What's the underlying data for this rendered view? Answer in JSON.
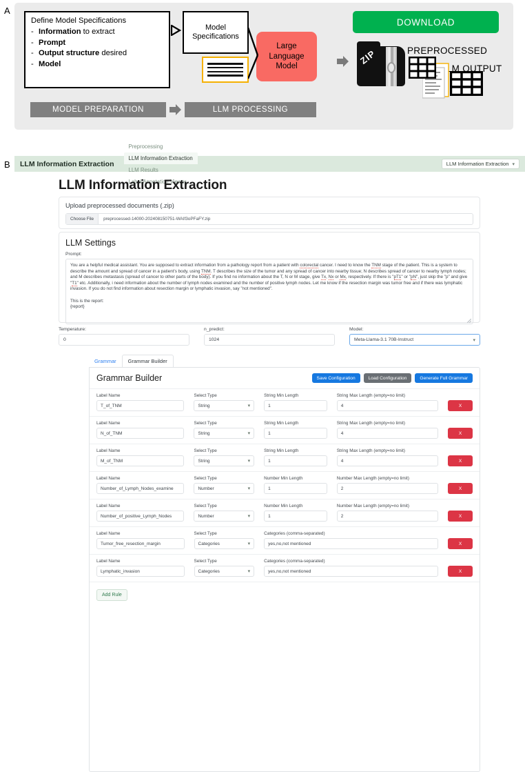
{
  "panels": {
    "a_letter": "A",
    "b_letter": "B"
  },
  "diagram": {
    "spec_box": {
      "title": "Define Model Specifications",
      "items": [
        {
          "bold": "Information",
          "rest": " to extract"
        },
        {
          "bold": "Prompt",
          "rest": ""
        },
        {
          "bold": "Output structure",
          "rest": " desired"
        },
        {
          "bold": "Model",
          "rest": ""
        }
      ]
    },
    "model_spec_box": "Model\nSpecifications",
    "llm_box": "Large\nLanguage\nModel",
    "download_button": "DOWNLOAD",
    "zip_label": "ZIP",
    "preprocessed_label": "PREPROCESSED",
    "llm_output_label": "LLM OUTPUT",
    "band_left": "MODEL PREPARATION",
    "band_right": "LLM PROCESSING",
    "colors": {
      "llm_box": "#f96a63",
      "download": "#00b14f",
      "band": "#808080",
      "doc_border": "#f5b000",
      "background": "#ebebeb"
    }
  },
  "app": {
    "nav": {
      "brand": "LLM Information Extraction",
      "tabs": [
        {
          "label": "Preprocessing",
          "active": false
        },
        {
          "label": "LLM Information Extraction",
          "active": true
        },
        {
          "label": "LLM Results",
          "active": false
        },
        {
          "label": "Label Annotation Viewer",
          "active": false
        }
      ],
      "select_value": "LLM Information Extraction",
      "caret_icon": "chevron-down-icon"
    },
    "page_title": "LLM Information Extraction",
    "upload": {
      "label": "Upload preprocessed documents (.zip)",
      "choose_file_label": "Choose File",
      "file_name": "preprocessed-14000-202408150751-WAIf3oPFaFY.zip"
    },
    "settings": {
      "title": "LLM Settings",
      "prompt_label": "Prompt:",
      "prompt_text": "You are a helpful medical assistant. You are supposed to extract information from a pathology report from a patient with colorectal cancer. I need to know the TNM stage of the patient. This is a system to describe the amount and spread of cancer in a patient's body, using TNM. T describes the size of the tumor and any spread of cancer into nearby tissue; N describes spread of cancer to nearby lymph nodes; and M describes metastasis (spread of cancer to other parts of the body). If you find no information about the T, N or M stage, give Tx, Nx or Mx, respectively. If there is \"pT1\" or \"pN\", just skip the \"p\" and give \"T1\" etc. Additionally, i need information about the number of lymph nodes examined and the number of positive lymph nodes. Let me know if the resection margin was tumor free and if there was lymphatic invasion. If you do not find information about resection margin or lymphatic invasion, say \"not mentioned\".",
      "prompt_text_tail_1": "This is the report:",
      "prompt_text_tail_2": "{report}",
      "params": [
        {
          "label": "Temperature:",
          "value": "0"
        },
        {
          "label": "n_predict:",
          "value": "1024"
        }
      ],
      "model_label": "Model:",
      "model_value": "Meta-Llama-3.1 70B-Instruct"
    },
    "grammar_tabs": [
      {
        "label": "Grammar",
        "active": false
      },
      {
        "label": "Grammar Builder",
        "active": true
      }
    ],
    "builder": {
      "title": "Grammar Builder",
      "buttons": [
        {
          "label": "Save Configuration",
          "style": "blue"
        },
        {
          "label": "Load Configuration",
          "style": "gray"
        },
        {
          "label": "Generate Full Grammar",
          "style": "blue"
        }
      ],
      "labels": {
        "label_name": "Label Name",
        "select_type": "Select Type",
        "string_min": "String Min Length",
        "string_max": "String Max Length (empty=no limit)",
        "number_min": "Number Min Length",
        "number_max": "Number Max Length (empty=no limit)",
        "categories": "Categories (comma-separated)"
      },
      "delete_label": "X",
      "add_rule_label": "Add Rule",
      "rules": [
        {
          "name": "T_of_TNM",
          "type": "String",
          "min": "1",
          "max": "4",
          "categories": null
        },
        {
          "name": "N_of_TNM",
          "type": "String",
          "min": "1",
          "max": "4",
          "categories": null
        },
        {
          "name": "M_of_TNM",
          "type": "String",
          "min": "1",
          "max": "4",
          "categories": null
        },
        {
          "name": "Number_of_Lymph_Nodes_examine",
          "type": "Number",
          "min": "1",
          "max": "2",
          "categories": null
        },
        {
          "name": "Number_of_positive_Lymph_Nodes",
          "type": "Number",
          "min": "1",
          "max": "2",
          "categories": null
        },
        {
          "name": "Tumor_free_resection_margin",
          "type": "Categories",
          "min": null,
          "max": null,
          "categories": "yes,no,not mentioned"
        },
        {
          "name": "Lymphatic_invasion",
          "type": "Categories",
          "min": null,
          "max": null,
          "categories": "yes,no,not mentioned"
        }
      ]
    }
  }
}
